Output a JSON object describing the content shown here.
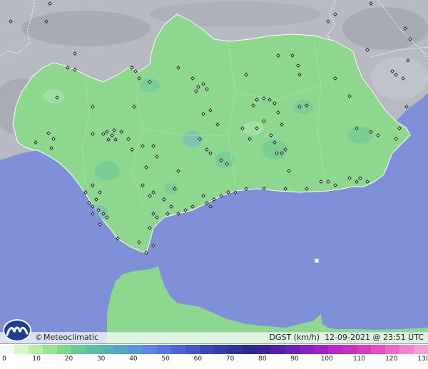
{
  "brand": {
    "copyright": "©",
    "name": "Meteoclimatic"
  },
  "info": {
    "variable": "DGST",
    "unit": "(km/h)",
    "datetime": "12-09-2021 @ 23:51 UTC"
  },
  "scale": {
    "labels": [
      "0",
      "10",
      "20",
      "30",
      "40",
      "50",
      "60",
      "70",
      "80",
      "90",
      "100",
      "110",
      "120",
      "130"
    ],
    "colors": [
      "#f4fbf1",
      "#d6f5cc",
      "#b8edaa",
      "#98e493",
      "#7ed98c",
      "#68cc90",
      "#5cbf9f",
      "#58b2b6",
      "#5aa4cb",
      "#5a95da",
      "#5c86e4",
      "#5676e0",
      "#4c66d6",
      "#4356c8",
      "#3a48b8",
      "#333da8",
      "#2e3398",
      "#2a2b88",
      "#3a2598",
      "#5422aa",
      "#6c22b8",
      "#8623c2",
      "#a025c8",
      "#b828c8",
      "#cc2fc4",
      "#dd3bbf",
      "#e54fc0",
      "#ec69c8",
      "#f183d2",
      "#f59edc"
    ]
  },
  "colors": {
    "sea": "#7f8fd8",
    "land": "#8dd88e",
    "relief": "#b9bcc4"
  }
}
